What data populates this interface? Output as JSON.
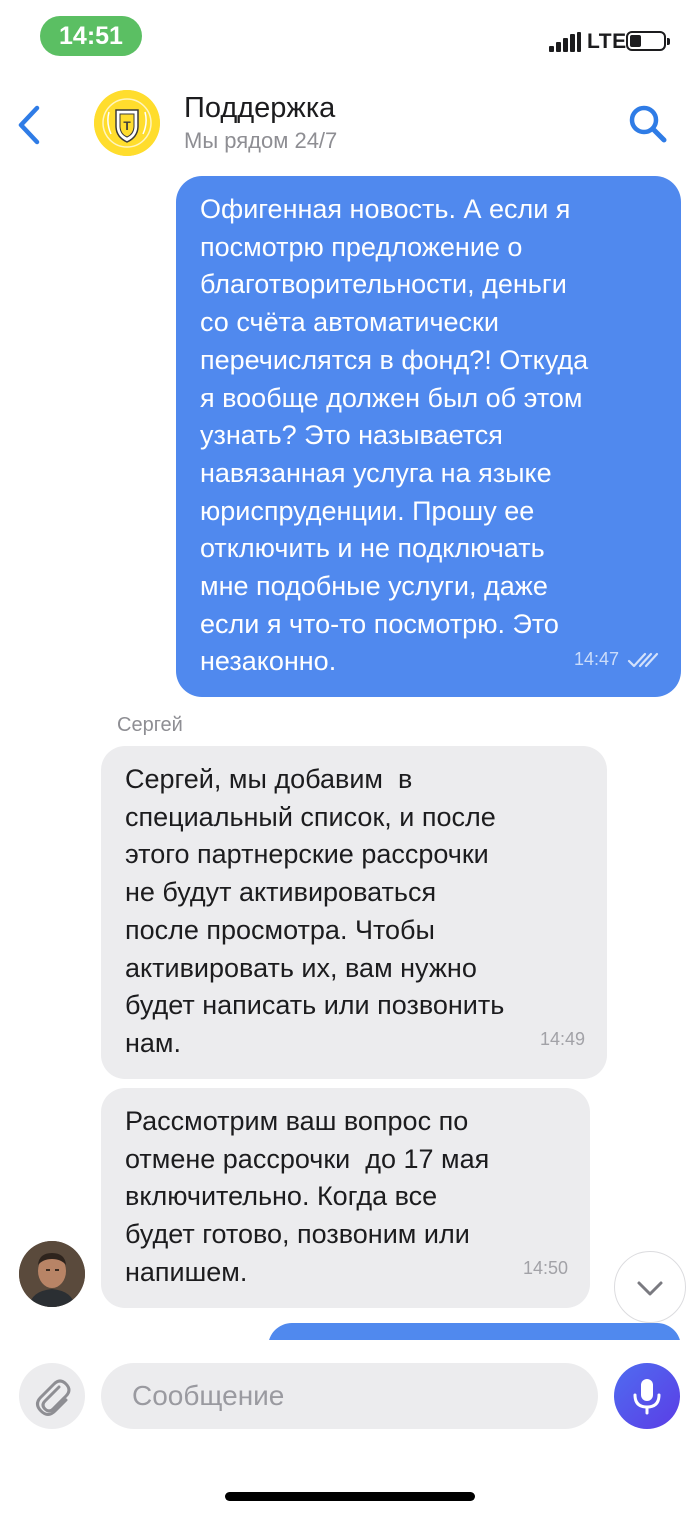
{
  "status_bar": {
    "time": "14:51",
    "network": "LTE",
    "time_pill_color": "#5bbf63"
  },
  "header": {
    "title": "Поддержка",
    "subtitle": "Мы рядом 24/7",
    "back_icon": "chevron-left-icon",
    "search_icon": "search-icon",
    "accent_color": "#2f7ce6"
  },
  "messages": [
    {
      "direction": "outgoing",
      "text": "Офигенная новость. А если я\nпосмотрю предложение о\nблаготворительности, деньги\nсо счёта автоматически\nперечислятся в фонд?! Откуда\nя вообще должен был об этом\nузнать? Это называется\nнавязанная услуга на языке\nюриспруденции. Прошу ее\nотключить и не подключать\nмне подобные услуги, даже\nесли я что-то посмотрю. Это\nнезаконно.",
      "time": "14:47",
      "status_icon": "double-check-icon"
    },
    {
      "direction": "incoming",
      "sender": "Сергей",
      "text": "Сергей, мы добавим  в\nспециальный список, и после\nэтого партнерские рассрочки\nне будут активироваться\nпосле просмотра. Чтобы\nактивировать их, вам нужно\nбудет написать или позвонить\nнам.",
      "time": "14:49"
    },
    {
      "direction": "incoming",
      "text": "Рассмотрим ваш вопрос по\nотмене рассрочки  до 17 мая\nвключительно. Когда все\nбудет готово, позвоним или\nнапишем.",
      "time": "14:50"
    }
  ],
  "composer": {
    "placeholder": "Сообщение",
    "value": "",
    "attach_icon": "paperclip-icon",
    "mic_icon": "microphone-icon"
  },
  "colors": {
    "outgoing_bubble": "#5089ee",
    "incoming_bubble": "#ececee",
    "logo_yellow": "#ffdd2d"
  }
}
